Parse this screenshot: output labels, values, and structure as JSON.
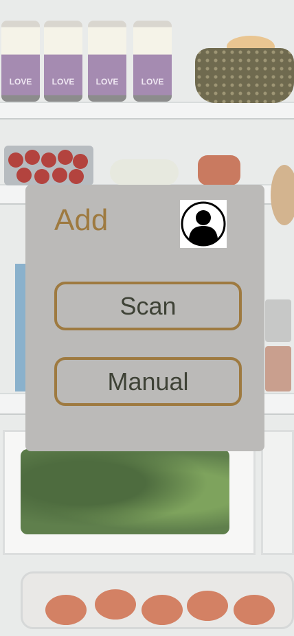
{
  "dialog": {
    "title": "Add",
    "avatar_icon": "user-profile-icon",
    "buttons": [
      {
        "label": "Scan"
      },
      {
        "label": "Manual"
      }
    ]
  },
  "colors": {
    "accent": "#9e7a40",
    "card_background": "#bbbab8",
    "button_text": "#3e4236"
  },
  "background": {
    "description_icon": "fridge-photo",
    "can_label": "LOVE"
  }
}
